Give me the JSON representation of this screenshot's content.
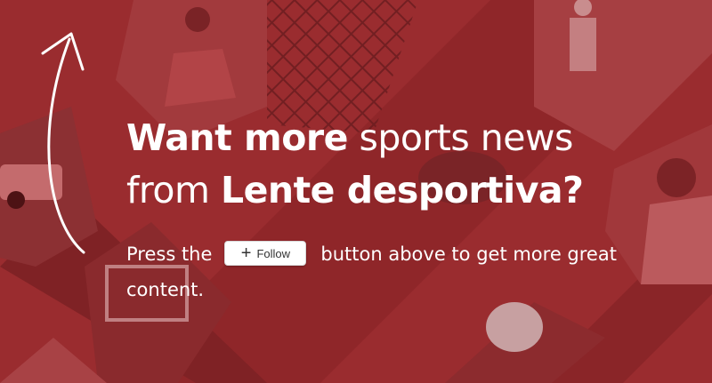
{
  "headline": {
    "line1_bold": "Want more",
    "line1_light": " sports news",
    "line2_light": "from ",
    "line2_bold": "Lente desportiva?"
  },
  "body": {
    "before_button": "Press the",
    "after_button": "button above to get more great content."
  },
  "follow_button": {
    "icon": "plus-icon",
    "label": "Follow"
  },
  "colors": {
    "background": "#9a2c2f",
    "text": "#ffffff",
    "button_bg": "#ffffff"
  }
}
